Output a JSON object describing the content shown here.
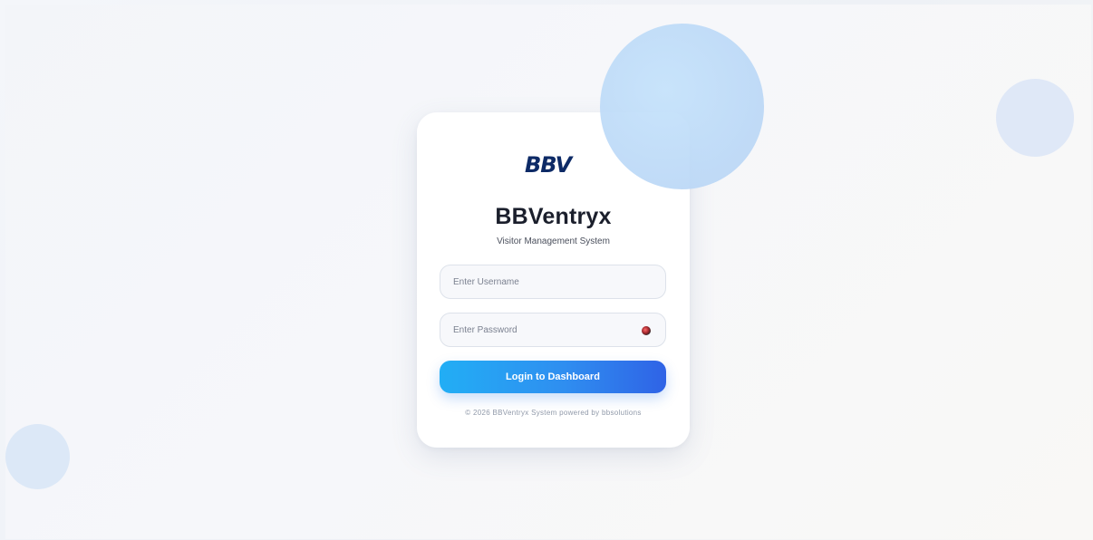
{
  "brand": {
    "logo_text": "BBV",
    "app_name": "BBVentryx",
    "subtitle": "Visitor Management System"
  },
  "login_form": {
    "username_placeholder": "Enter Username",
    "password_placeholder": "Enter Password",
    "password_toggle_icon": "eye-icon",
    "submit_label": "Login to Dashboard"
  },
  "footer": {
    "text": "© 2026 BBVentryx System powered by bbsolutions"
  },
  "colors": {
    "title": "#1b1f2c",
    "button_start": "#22aef5",
    "button_end": "#2f63e6",
    "logo": "#0d2a66",
    "logo_accent": "#1e88e5"
  }
}
